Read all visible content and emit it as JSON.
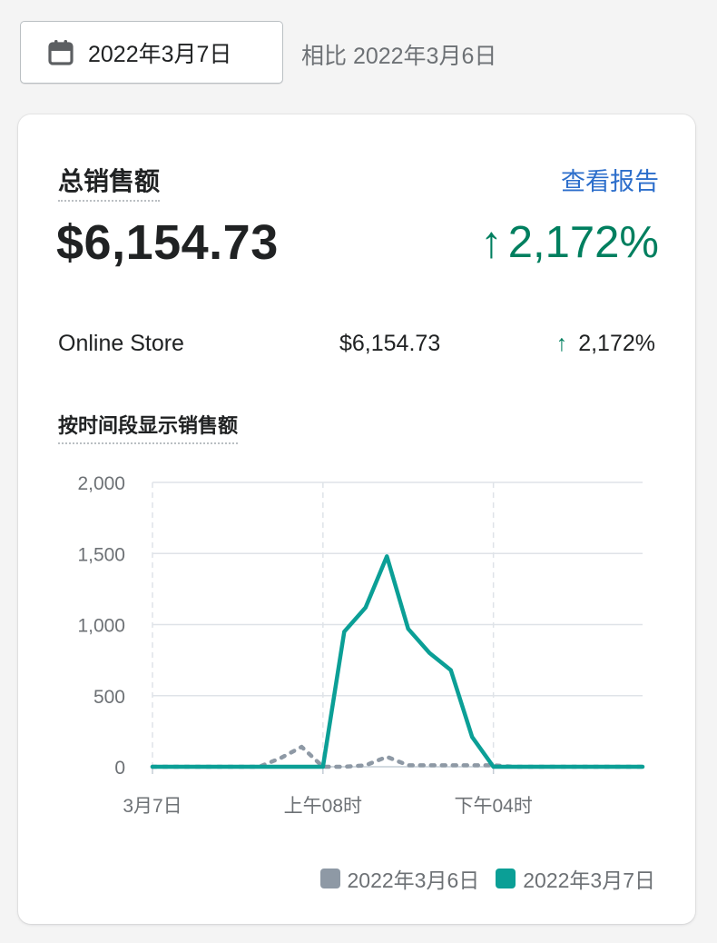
{
  "header": {
    "date_label": "2022年3月7日",
    "calendar_icon": "calendar-icon",
    "compare_label": "相比 2022年3月6日"
  },
  "card": {
    "title": "总销售额",
    "view_report": "查看报告",
    "total": "$6,154.73",
    "growth": "2,172%",
    "growth_arrow": "↑",
    "rows": [
      {
        "name": "Online Store",
        "amount": "$6,154.73",
        "arrow": "↑",
        "growth": "2,172%"
      }
    ],
    "subtitle": "按时间段显示销售额"
  },
  "colors": {
    "primary": "#0b9f96",
    "compare": "#8e99a5",
    "positive": "#007f5f",
    "link": "#2c6ecb"
  },
  "chart_data": {
    "type": "line",
    "x": [
      0,
      1,
      2,
      3,
      4,
      5,
      6,
      7,
      8,
      9,
      10,
      11,
      12,
      13,
      14,
      15,
      16,
      17,
      18,
      19,
      20,
      21,
      22,
      23
    ],
    "x_tick_labels": [
      {
        "at": 0,
        "label": "3月7日"
      },
      {
        "at": 8,
        "label": "上午08时"
      },
      {
        "at": 16,
        "label": "下午04时"
      }
    ],
    "ylim": [
      0,
      2000
    ],
    "y_ticks": [
      {
        "value": 0,
        "label": "0"
      },
      {
        "value": 500,
        "label": "500"
      },
      {
        "value": 1000,
        "label": "1,000"
      },
      {
        "value": 1500,
        "label": "1,500"
      },
      {
        "value": 2000,
        "label": "2,000"
      }
    ],
    "series": [
      {
        "name": "2022年3月6日",
        "style": "dotted",
        "values": [
          0,
          0,
          0,
          0,
          0,
          0,
          60,
          140,
          0,
          0,
          10,
          70,
          10,
          10,
          10,
          10,
          10,
          0,
          0,
          0,
          0,
          0,
          0,
          0
        ]
      },
      {
        "name": "2022年3月7日",
        "style": "solid",
        "values": [
          0,
          0,
          0,
          0,
          0,
          0,
          0,
          0,
          0,
          950,
          1120,
          1480,
          970,
          800,
          680,
          210,
          0,
          0,
          0,
          0,
          0,
          0,
          0,
          0
        ]
      }
    ],
    "legend_position": "bottom-right"
  }
}
